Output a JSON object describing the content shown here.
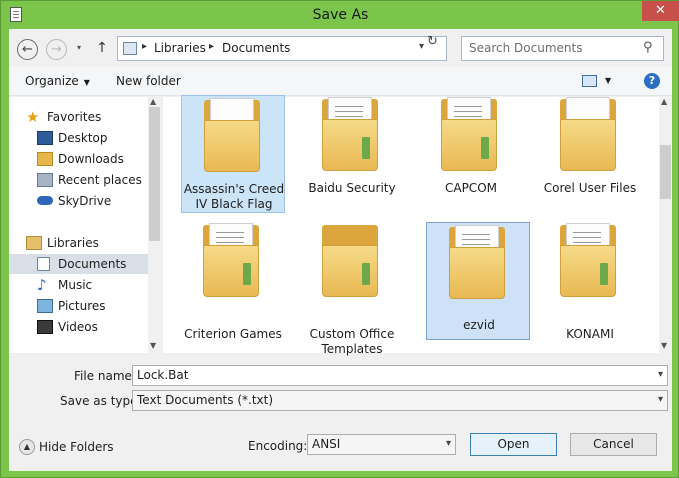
{
  "window": {
    "title": "Save As",
    "close_glyph": "✕"
  },
  "nav": {
    "back_glyph": "←",
    "forward_glyph": "→",
    "up_glyph": "↑",
    "recent_glyph": "▾"
  },
  "address": {
    "crumbs": [
      "Libraries",
      "Documents"
    ],
    "separator": "▸",
    "dropdown_glyph": "▾",
    "refresh_glyph": "↻"
  },
  "search": {
    "placeholder": "Search Documents",
    "icon_glyph": "⚲"
  },
  "toolbar": {
    "organize": "Organize",
    "organize_caret": "▼",
    "new_folder": "New folder",
    "view_caret": "▼",
    "help_glyph": "?"
  },
  "sidebar": {
    "items": [
      {
        "label": "Favorites",
        "icon": "star-icon"
      },
      {
        "label": "Desktop",
        "icon": "desktop-icon"
      },
      {
        "label": "Downloads",
        "icon": "downloads-icon"
      },
      {
        "label": "Recent places",
        "icon": "recent-places-icon"
      },
      {
        "label": "SkyDrive",
        "icon": "skydrive-icon"
      },
      {
        "label": "Libraries",
        "icon": "libraries-icon"
      },
      {
        "label": "Documents",
        "icon": "documents-icon",
        "selected": true
      },
      {
        "label": "Music",
        "icon": "music-icon"
      },
      {
        "label": "Pictures",
        "icon": "pictures-icon"
      },
      {
        "label": "Videos",
        "icon": "videos-icon"
      }
    ]
  },
  "files": [
    {
      "label": "Assassin's Creed IV Black Flag",
      "selected": true
    },
    {
      "label": "Baidu Security"
    },
    {
      "label": "CAPCOM"
    },
    {
      "label": "Corel User Files"
    },
    {
      "label": "Criterion Games"
    },
    {
      "label": "Custom Office Templates"
    },
    {
      "label": "ezvid",
      "selected": true
    },
    {
      "label": "KONAMI"
    }
  ],
  "scroll": {
    "up_glyph": "▲",
    "down_glyph": "▼"
  },
  "form": {
    "file_name_label": "File name:",
    "file_name_value": "Lock.Bat",
    "save_type_label": "Save as type:",
    "save_type_value": "Text Documents (*.txt)",
    "dropdown_glyph": "▾",
    "encoding_label": "Encoding:",
    "encoding_value": "ANSI"
  },
  "footer": {
    "hide_folders": "Hide Folders",
    "hide_folders_glyph": "▲",
    "open": "Open",
    "cancel": "Cancel"
  }
}
